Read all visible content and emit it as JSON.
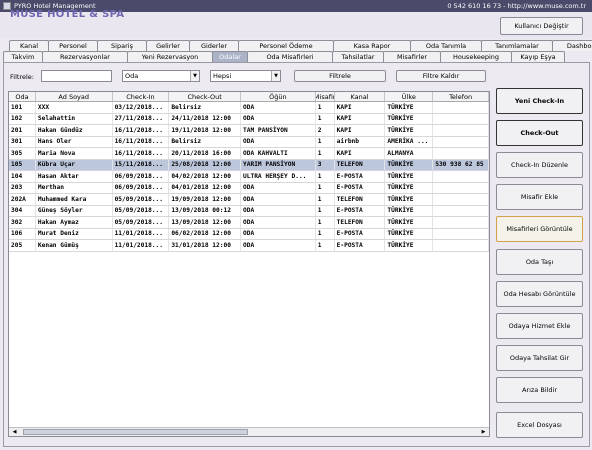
{
  "window": {
    "title": "PYRO Hotel Management",
    "contact": "0 542 610 16 73 - http://www.muse.com.tr"
  },
  "brand": "MUSE HOTEL & SPA",
  "user_button": "Kullanıcı Değiştir",
  "tabs_top": [
    "Kanal",
    "Personel",
    "Sipariş",
    "Gelirler",
    "Giderler",
    "Personel Ödeme",
    "Kasa Rapor",
    "Oda Tanımla",
    "Tanımlamalar",
    "Dashboard"
  ],
  "tabs_bottom": [
    "Takvim",
    "Rezervasyonlar",
    "Yeni Rezervasyon",
    "Odalar",
    "Oda Misafirleri",
    "Tahsilatlar",
    "Misafirler",
    "Housekeeping",
    "Kayıp Eşya"
  ],
  "filter": {
    "label": "Filtrele:",
    "text_value": "",
    "field_value": "Oda",
    "status_value": "Hepsi",
    "filter_button": "Filtrele",
    "clear_button": "Filtre Kaldır"
  },
  "table": {
    "columns": [
      "Oda",
      "Ad Soyad",
      "Check-In",
      "Check-Out",
      "Öğün",
      "Misafir",
      "Kanal",
      "Ülke",
      "Telefon"
    ],
    "rows": [
      [
        "101",
        "XXX",
        "03/12/2018...",
        "Belirsiz",
        "ODA",
        "1",
        "KAPI",
        "TÜRKİYE",
        ""
      ],
      [
        "102",
        "Selahattin",
        "27/11/2018...",
        "24/11/2018 12:00",
        "ODA",
        "1",
        "KAPI",
        "TÜRKİYE",
        ""
      ],
      [
        "201",
        "Hakan Gündüz",
        "16/11/2018...",
        "19/11/2018 12:00",
        "TAM PANSİYON",
        "2",
        "KAPI",
        "TÜRKİYE",
        ""
      ],
      [
        "301",
        "Hans Oler",
        "16/11/2018...",
        "Belirsiz",
        "ODA",
        "1",
        "airbnb",
        "AMERİKA ...",
        ""
      ],
      [
        "305",
        "Maria Nova",
        "16/11/2018...",
        "20/11/2018 16:00",
        "ODA KAHVALTI",
        "1",
        "KAPI",
        "ALMANYA",
        ""
      ],
      [
        "105",
        "Kübra Uçar",
        "15/11/2018...",
        "25/08/2018 12:00",
        "YARIM PANSİYON",
        "3",
        "TELEFON",
        "TÜRKİYE",
        "530 938 62 85"
      ],
      [
        "104",
        "Hasan Aktar",
        "06/09/2018...",
        "04/02/2018 12:00",
        "ULTRA HERŞEY D...",
        "1",
        "E-POSTA",
        "TÜRKİYE",
        ""
      ],
      [
        "203",
        "Merthan",
        "06/09/2018...",
        "04/01/2018 12:00",
        "ODA",
        "1",
        "E-POSTA",
        "TÜRKİYE",
        ""
      ],
      [
        "202A",
        "Muhammed Kara",
        "05/09/2018...",
        "19/09/2018 12:00",
        "ODA",
        "1",
        "TELEFON",
        "TÜRKİYE",
        ""
      ],
      [
        "304",
        "Güneş Söyler",
        "05/09/2018...",
        "13/09/2018 00:12",
        "ODA",
        "1",
        "E-POSTA",
        "TÜRKİYE",
        ""
      ],
      [
        "302",
        "Hakan Aymaz",
        "05/09/2018...",
        "13/09/2018 12:00",
        "ODA",
        "1",
        "TELEFON",
        "TÜRKİYE",
        ""
      ],
      [
        "106",
        "Murat Deniz",
        "11/01/2018...",
        "06/02/2018 12:00",
        "ODA",
        "1",
        "E-POSTA",
        "TÜRKİYE",
        ""
      ],
      [
        "205",
        "Kenan Gümüş",
        "11/01/2018...",
        "31/01/2018 12:00",
        "ODA",
        "1",
        "E-POSTA",
        "TÜRKİYE",
        ""
      ]
    ],
    "selected_row": 5
  },
  "side_buttons": [
    "Yeni Check-In",
    "Check-Out",
    "Check-In Düzenle",
    "Misafir Ekle",
    "Misafirleri Görüntüle",
    "Oda Taşı",
    "Oda Hesabı Görüntüle",
    "Odaya Hizmet Ekle",
    "Odaya Tahsilat Gir",
    "Arıza Bildir",
    "Excel Dosyası"
  ]
}
